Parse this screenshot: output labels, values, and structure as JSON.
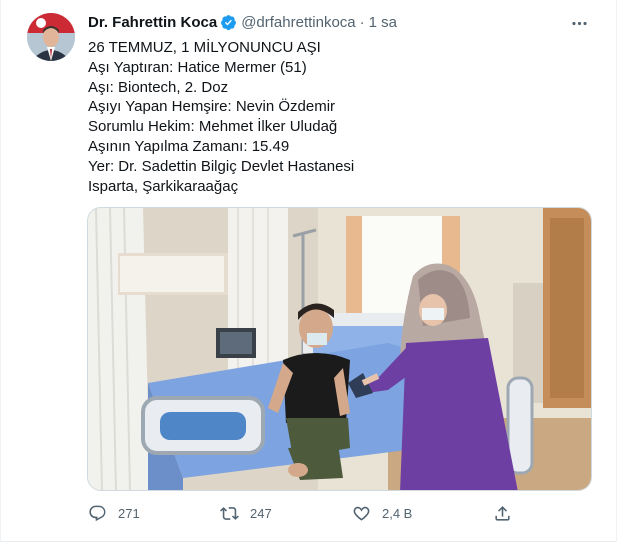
{
  "tweet": {
    "author": {
      "display_name": "Dr. Fahrettin Koca",
      "handle": "@drfahrettinkoca",
      "verified": true,
      "avatar_icon": "profile-photo"
    },
    "separator": "·",
    "time": "1 sa",
    "more_icon": "more-horizontal-icon",
    "text_lines": [
      "26 TEMMUZ, 1 MİLYONUNCU AŞI",
      "Aşı Yaptıran: Hatice Mermer (51)",
      "Aşı: Biontech, 2. Doz",
      "Aşıyı Yapan Hemşire: Nevin Özdemir",
      "Sorumlu Hekim: Mehmet İlker Uludağ",
      "Aşının Yapılma Zamanı: 15.49",
      "Yer: Dr. Sadettin Bilgiç Devlet Hastanesi",
      "Isparta, Şarkikaraağaç"
    ],
    "media": {
      "type": "photo"
    },
    "actions": {
      "reply": {
        "icon": "reply-icon",
        "count": "271"
      },
      "retweet": {
        "icon": "retweet-icon",
        "count": "247"
      },
      "like": {
        "icon": "heart-icon",
        "count": "2,4 B"
      },
      "share": {
        "icon": "share-icon"
      }
    }
  },
  "colors": {
    "verified_blue": "#1d9bf0",
    "secondary_text": "#536471",
    "primary_text": "#0f1419",
    "nurse_uniform": "#6e3fa3",
    "bed_sheet": "#7da3e0"
  }
}
